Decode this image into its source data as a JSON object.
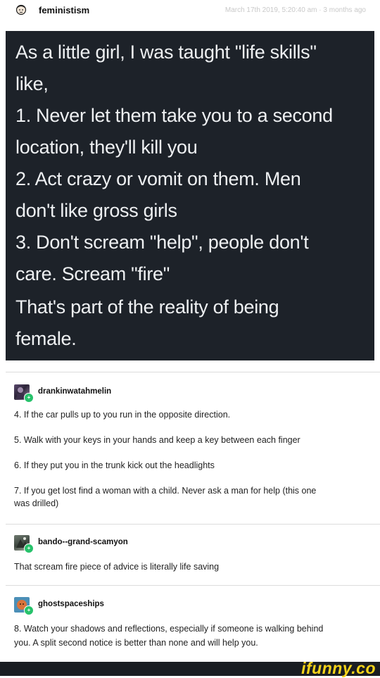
{
  "post": {
    "username": "feministism",
    "timestamp": "March 17th 2019, 5:20:40 am · 3 months ago",
    "quote_lines": [
      "As a little girl, I was taught \"life skills\"",
      "like,",
      "1. Never let them take you to a second",
      "location, they'll kill you",
      "2. Act crazy or vomit on them. Men",
      "don't like gross girls",
      "3. Don't scream \"help\", people don't",
      "care. Scream \"fire\""
    ],
    "quote_closing_lines": [
      "That's part of the reality of being",
      "female."
    ]
  },
  "replies": [
    {
      "username": "drankinwatahmelin",
      "lines": [
        "4. If the car pulls up to you run in the opposite direction.",
        "5. Walk with your keys in your hands and keep a key between each finger",
        "6. If they put you in the trunk kick out the headlights",
        "7. If you get lost find a woman with a child. Never ask a man for help (this one",
        "was drilled)"
      ]
    },
    {
      "username": "bando--grand-scamyon",
      "lines": [
        "That scream fire piece of advice is literally life saving"
      ]
    },
    {
      "username": "ghostspaceships",
      "lines": [
        "8. Watch your shadows and reflections, especially if someone is walking behind",
        "you. A split second notice is better than none and will help you."
      ]
    }
  ],
  "watermark": "ifunny.co",
  "colors": {
    "quote_bg": "#1d2229",
    "badge": "#27c26b",
    "logo": "#f6d41a"
  }
}
